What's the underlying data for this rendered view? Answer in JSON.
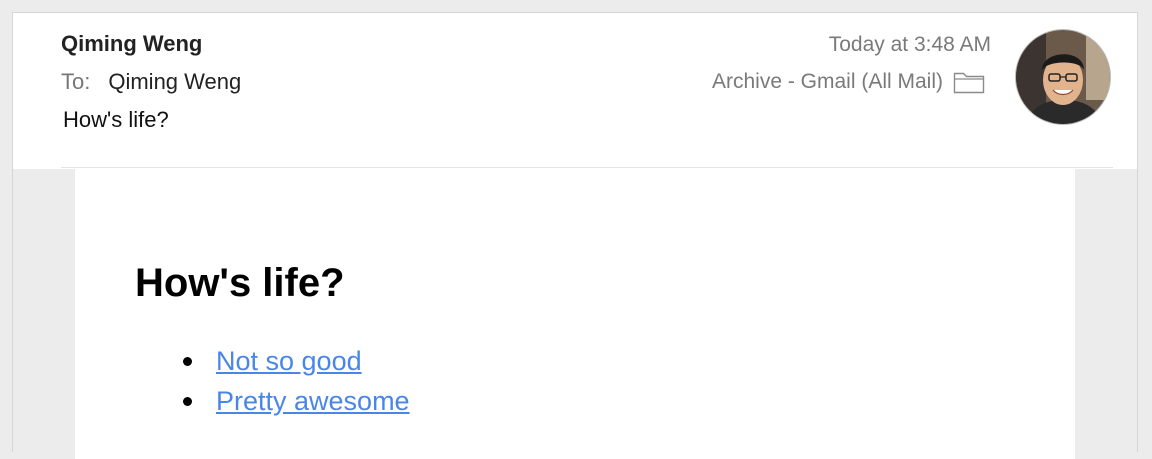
{
  "header": {
    "sender": "Qiming Weng",
    "to_label": "To:",
    "recipient": "Qiming Weng",
    "subject": "How's life?",
    "timestamp": "Today at 3:48 AM",
    "mailbox": "Archive - Gmail (All Mail)",
    "mailbox_icon": "folder-icon",
    "avatar_icon": "avatar-photo"
  },
  "body": {
    "heading": "How's life?",
    "options": [
      {
        "label": "Not so good"
      },
      {
        "label": "Pretty awesome"
      }
    ]
  },
  "colors": {
    "link": "#4a86e8",
    "meta_text": "#7a7a7a",
    "background": "#ececec"
  }
}
